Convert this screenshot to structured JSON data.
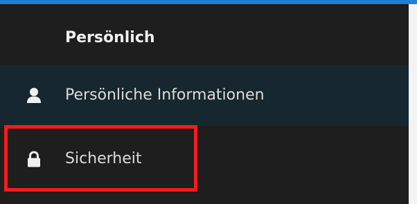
{
  "header": {
    "section_title": "Persönlich"
  },
  "nav": {
    "items": [
      {
        "label": "Persönliche Informationen",
        "icon": "user-icon",
        "active": true
      },
      {
        "label": "Sicherheit",
        "icon": "lock-icon",
        "active": false
      }
    ]
  },
  "colors": {
    "accent_top_bar": "#1d7fd6",
    "sidebar_bg": "#1e1e1e",
    "active_item_bg": "#172730",
    "highlight_border": "#ff1a1a"
  }
}
